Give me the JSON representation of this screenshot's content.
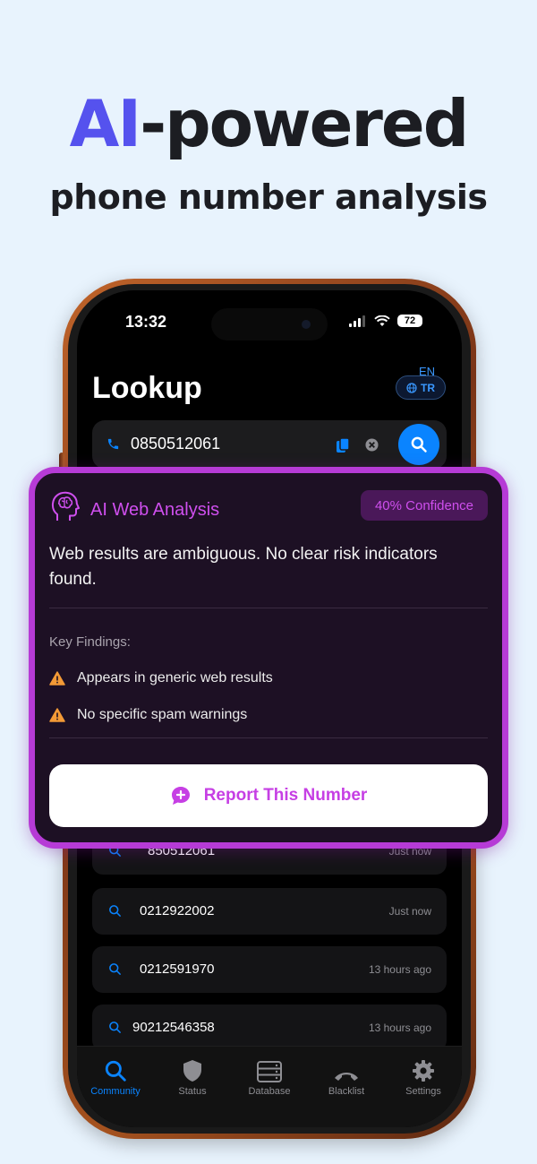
{
  "headline": {
    "ai": "AI",
    "powered": "-powered",
    "subtitle": "phone number analysis"
  },
  "status_bar": {
    "time": "13:32",
    "battery": "72"
  },
  "screen": {
    "title": "Lookup",
    "language": {
      "current": "EN",
      "alternate": "TR"
    },
    "search": {
      "value": "0850512061"
    }
  },
  "ai_card": {
    "title": "AI Web Analysis",
    "confidence": "40% Confidence",
    "summary": "Web results are ambiguous. No clear risk indicators found.",
    "findings_label": "Key Findings:",
    "findings": [
      "Appears in generic web results",
      "No specific spam warnings"
    ],
    "report_button": "Report This Number"
  },
  "history": [
    {
      "number": "850512061",
      "time": "Just now"
    },
    {
      "number": "0212922002",
      "time": "Just now"
    },
    {
      "number": "0212591970",
      "time": "13 hours ago"
    },
    {
      "number": "90212546358",
      "time": "13 hours ago"
    }
  ],
  "tabs": [
    {
      "label": "Community",
      "icon": "search-icon",
      "active": true
    },
    {
      "label": "Status",
      "icon": "shield-icon",
      "active": false
    },
    {
      "label": "Database",
      "icon": "database-icon",
      "active": false
    },
    {
      "label": "Blacklist",
      "icon": "phone-hangup-icon",
      "active": false
    },
    {
      "label": "Settings",
      "icon": "gear-icon",
      "active": false
    }
  ],
  "colors": {
    "accent_ai": "#5552ee",
    "card_border": "#b63bd6",
    "card_text": "#cf4fee",
    "ios_blue": "#0a84ff",
    "warning": "#f39a36"
  }
}
